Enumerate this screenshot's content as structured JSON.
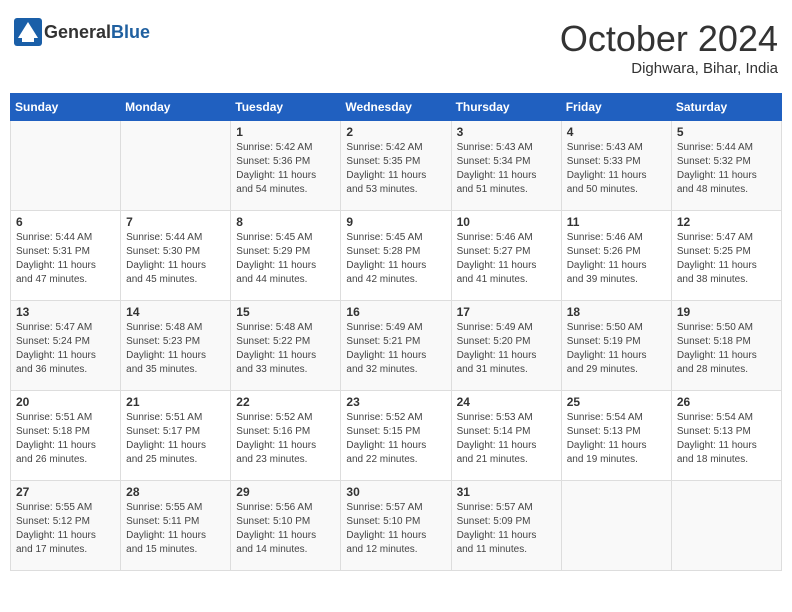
{
  "header": {
    "logo_general": "General",
    "logo_blue": "Blue",
    "month_title": "October 2024",
    "location": "Dighwara, Bihar, India"
  },
  "days_of_week": [
    "Sunday",
    "Monday",
    "Tuesday",
    "Wednesday",
    "Thursday",
    "Friday",
    "Saturday"
  ],
  "weeks": [
    [
      {
        "day": "",
        "sunrise": "",
        "sunset": "",
        "daylight": ""
      },
      {
        "day": "",
        "sunrise": "",
        "sunset": "",
        "daylight": ""
      },
      {
        "day": "1",
        "sunrise": "Sunrise: 5:42 AM",
        "sunset": "Sunset: 5:36 PM",
        "daylight": "Daylight: 11 hours and 54 minutes."
      },
      {
        "day": "2",
        "sunrise": "Sunrise: 5:42 AM",
        "sunset": "Sunset: 5:35 PM",
        "daylight": "Daylight: 11 hours and 53 minutes."
      },
      {
        "day": "3",
        "sunrise": "Sunrise: 5:43 AM",
        "sunset": "Sunset: 5:34 PM",
        "daylight": "Daylight: 11 hours and 51 minutes."
      },
      {
        "day": "4",
        "sunrise": "Sunrise: 5:43 AM",
        "sunset": "Sunset: 5:33 PM",
        "daylight": "Daylight: 11 hours and 50 minutes."
      },
      {
        "day": "5",
        "sunrise": "Sunrise: 5:44 AM",
        "sunset": "Sunset: 5:32 PM",
        "daylight": "Daylight: 11 hours and 48 minutes."
      }
    ],
    [
      {
        "day": "6",
        "sunrise": "Sunrise: 5:44 AM",
        "sunset": "Sunset: 5:31 PM",
        "daylight": "Daylight: 11 hours and 47 minutes."
      },
      {
        "day": "7",
        "sunrise": "Sunrise: 5:44 AM",
        "sunset": "Sunset: 5:30 PM",
        "daylight": "Daylight: 11 hours and 45 minutes."
      },
      {
        "day": "8",
        "sunrise": "Sunrise: 5:45 AM",
        "sunset": "Sunset: 5:29 PM",
        "daylight": "Daylight: 11 hours and 44 minutes."
      },
      {
        "day": "9",
        "sunrise": "Sunrise: 5:45 AM",
        "sunset": "Sunset: 5:28 PM",
        "daylight": "Daylight: 11 hours and 42 minutes."
      },
      {
        "day": "10",
        "sunrise": "Sunrise: 5:46 AM",
        "sunset": "Sunset: 5:27 PM",
        "daylight": "Daylight: 11 hours and 41 minutes."
      },
      {
        "day": "11",
        "sunrise": "Sunrise: 5:46 AM",
        "sunset": "Sunset: 5:26 PM",
        "daylight": "Daylight: 11 hours and 39 minutes."
      },
      {
        "day": "12",
        "sunrise": "Sunrise: 5:47 AM",
        "sunset": "Sunset: 5:25 PM",
        "daylight": "Daylight: 11 hours and 38 minutes."
      }
    ],
    [
      {
        "day": "13",
        "sunrise": "Sunrise: 5:47 AM",
        "sunset": "Sunset: 5:24 PM",
        "daylight": "Daylight: 11 hours and 36 minutes."
      },
      {
        "day": "14",
        "sunrise": "Sunrise: 5:48 AM",
        "sunset": "Sunset: 5:23 PM",
        "daylight": "Daylight: 11 hours and 35 minutes."
      },
      {
        "day": "15",
        "sunrise": "Sunrise: 5:48 AM",
        "sunset": "Sunset: 5:22 PM",
        "daylight": "Daylight: 11 hours and 33 minutes."
      },
      {
        "day": "16",
        "sunrise": "Sunrise: 5:49 AM",
        "sunset": "Sunset: 5:21 PM",
        "daylight": "Daylight: 11 hours and 32 minutes."
      },
      {
        "day": "17",
        "sunrise": "Sunrise: 5:49 AM",
        "sunset": "Sunset: 5:20 PM",
        "daylight": "Daylight: 11 hours and 31 minutes."
      },
      {
        "day": "18",
        "sunrise": "Sunrise: 5:50 AM",
        "sunset": "Sunset: 5:19 PM",
        "daylight": "Daylight: 11 hours and 29 minutes."
      },
      {
        "day": "19",
        "sunrise": "Sunrise: 5:50 AM",
        "sunset": "Sunset: 5:18 PM",
        "daylight": "Daylight: 11 hours and 28 minutes."
      }
    ],
    [
      {
        "day": "20",
        "sunrise": "Sunrise: 5:51 AM",
        "sunset": "Sunset: 5:18 PM",
        "daylight": "Daylight: 11 hours and 26 minutes."
      },
      {
        "day": "21",
        "sunrise": "Sunrise: 5:51 AM",
        "sunset": "Sunset: 5:17 PM",
        "daylight": "Daylight: 11 hours and 25 minutes."
      },
      {
        "day": "22",
        "sunrise": "Sunrise: 5:52 AM",
        "sunset": "Sunset: 5:16 PM",
        "daylight": "Daylight: 11 hours and 23 minutes."
      },
      {
        "day": "23",
        "sunrise": "Sunrise: 5:52 AM",
        "sunset": "Sunset: 5:15 PM",
        "daylight": "Daylight: 11 hours and 22 minutes."
      },
      {
        "day": "24",
        "sunrise": "Sunrise: 5:53 AM",
        "sunset": "Sunset: 5:14 PM",
        "daylight": "Daylight: 11 hours and 21 minutes."
      },
      {
        "day": "25",
        "sunrise": "Sunrise: 5:54 AM",
        "sunset": "Sunset: 5:13 PM",
        "daylight": "Daylight: 11 hours and 19 minutes."
      },
      {
        "day": "26",
        "sunrise": "Sunrise: 5:54 AM",
        "sunset": "Sunset: 5:13 PM",
        "daylight": "Daylight: 11 hours and 18 minutes."
      }
    ],
    [
      {
        "day": "27",
        "sunrise": "Sunrise: 5:55 AM",
        "sunset": "Sunset: 5:12 PM",
        "daylight": "Daylight: 11 hours and 17 minutes."
      },
      {
        "day": "28",
        "sunrise": "Sunrise: 5:55 AM",
        "sunset": "Sunset: 5:11 PM",
        "daylight": "Daylight: 11 hours and 15 minutes."
      },
      {
        "day": "29",
        "sunrise": "Sunrise: 5:56 AM",
        "sunset": "Sunset: 5:10 PM",
        "daylight": "Daylight: 11 hours and 14 minutes."
      },
      {
        "day": "30",
        "sunrise": "Sunrise: 5:57 AM",
        "sunset": "Sunset: 5:10 PM",
        "daylight": "Daylight: 11 hours and 12 minutes."
      },
      {
        "day": "31",
        "sunrise": "Sunrise: 5:57 AM",
        "sunset": "Sunset: 5:09 PM",
        "daylight": "Daylight: 11 hours and 11 minutes."
      },
      {
        "day": "",
        "sunrise": "",
        "sunset": "",
        "daylight": ""
      },
      {
        "day": "",
        "sunrise": "",
        "sunset": "",
        "daylight": ""
      }
    ]
  ]
}
